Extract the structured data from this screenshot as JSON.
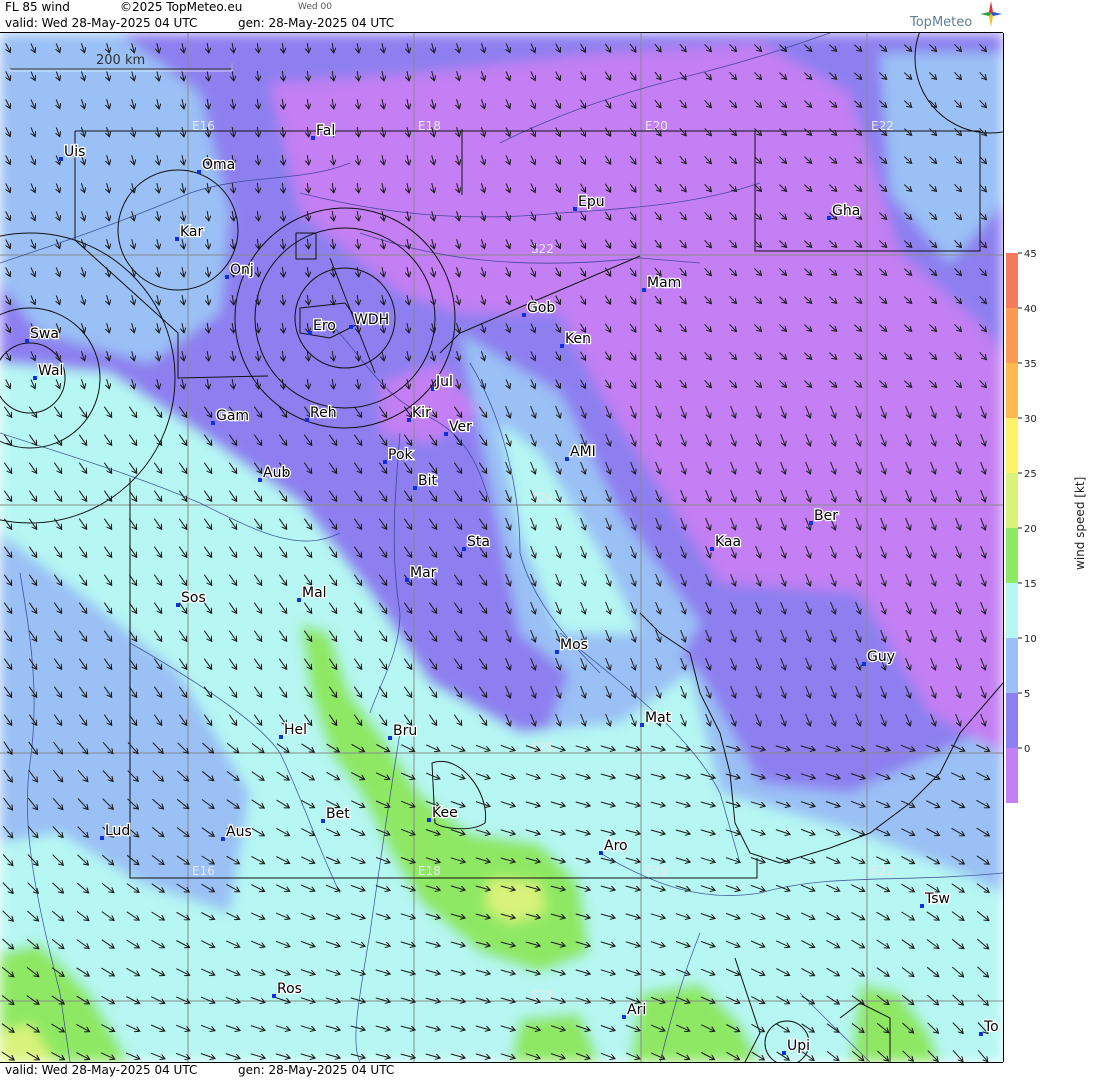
{
  "header": {
    "title": "FL 85 wind",
    "copyright": "©2025 TopMeteo.eu",
    "day_tag": "Wed 00",
    "valid": "valid:  Wed  28-May-2025  04 UTC",
    "gen": "gen: 28-May-2025 04 UTC",
    "logo": "TopMeteo"
  },
  "footer": {
    "valid": "valid:  Wed  28-May-2025  04 UTC",
    "gen": "gen: 28-May-2025 04 UTC"
  },
  "scale_bar": "200 km",
  "grid_labels": {
    "lon": [
      "E16",
      "E18",
      "E20",
      "E22"
    ],
    "lat": [
      "S22",
      "S24",
      "S26",
      "S28"
    ]
  },
  "places": [
    {
      "name": "Uis"
    },
    {
      "name": "Oma"
    },
    {
      "name": "Fal"
    },
    {
      "name": "Kar"
    },
    {
      "name": "Epu"
    },
    {
      "name": "Gha"
    },
    {
      "name": "Onj"
    },
    {
      "name": "Mam"
    },
    {
      "name": "Gob"
    },
    {
      "name": "WDH"
    },
    {
      "name": "Swa"
    },
    {
      "name": "Ero"
    },
    {
      "name": "Ken"
    },
    {
      "name": "Wal"
    },
    {
      "name": "Jul"
    },
    {
      "name": "Gam"
    },
    {
      "name": "Reh"
    },
    {
      "name": "Kir"
    },
    {
      "name": "Ver"
    },
    {
      "name": "AMI"
    },
    {
      "name": "Pok"
    },
    {
      "name": "Aub"
    },
    {
      "name": "Bit"
    },
    {
      "name": "Ber"
    },
    {
      "name": "Sta"
    },
    {
      "name": "Kaa"
    },
    {
      "name": "Mar"
    },
    {
      "name": "Sos"
    },
    {
      "name": "Mal"
    },
    {
      "name": "Mos"
    },
    {
      "name": "Guy"
    },
    {
      "name": "Mat"
    },
    {
      "name": "Hel"
    },
    {
      "name": "Bru"
    },
    {
      "name": "Bet"
    },
    {
      "name": "Kee"
    },
    {
      "name": "Lud"
    },
    {
      "name": "Aus"
    },
    {
      "name": "Aro"
    },
    {
      "name": "Tsw"
    },
    {
      "name": "Ros"
    },
    {
      "name": "Ari"
    },
    {
      "name": "To"
    },
    {
      "name": "Upi"
    }
  ],
  "legend": {
    "title": "wind speed [kt]",
    "ticks": [
      "45",
      "40",
      "35",
      "30",
      "25",
      "20",
      "15",
      "10",
      "5",
      "0"
    ],
    "colors": [
      "#f47a5d",
      "#f99a55",
      "#fbb94f",
      "#fdf26a",
      "#d9f37a",
      "#8ee864",
      "#b6f7f3",
      "#9ac0f5",
      "#8d7ff0",
      "#c37ff3"
    ]
  },
  "colors": {
    "calm_purple": "#c37ff3",
    "light_wind_blue": "#8d7ff0",
    "moderate_blue": "#9ac0f5",
    "cyan": "#b6f7f3",
    "green": "#8ee864",
    "yellowgreen": "#d9f37a"
  }
}
